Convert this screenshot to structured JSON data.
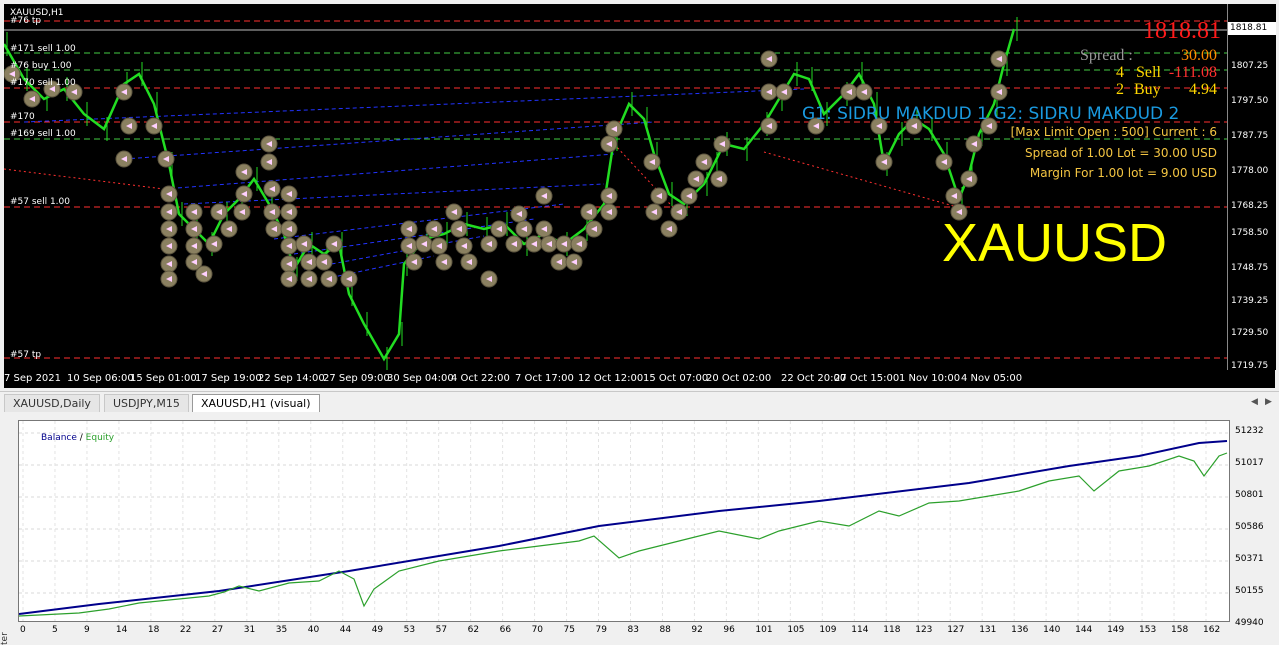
{
  "chart": {
    "window_title": "XAUUSD,H1",
    "current_price_tag": "1818.81",
    "price_ticks": [
      "1807.25",
      "1797.50",
      "1787.75",
      "1778.00",
      "1768.25",
      "1758.50",
      "1748.75",
      "1739.25",
      "1729.50",
      "1719.75"
    ],
    "time_ticks": [
      "7 Sep 2021",
      "10 Sep 06:00",
      "15 Sep 01:00",
      "17 Sep 19:00",
      "22 Sep 14:00",
      "27 Sep 09:00",
      "30 Sep 04:00",
      "4 Oct 22:00",
      "7 Oct 17:00",
      "12 Oct 12:00",
      "15 Oct 07:00",
      "20 Oct 02:00",
      "22 Oct 20:00",
      "27 Oct 15:00",
      "1 Nov 10:00",
      "4 Nov 05:00"
    ],
    "trade_labels": {
      "l1": "#76 tp",
      "l2": "#171 sell 1.00",
      "l3": "#76 buy 1.00",
      "l4": "#170 sell 1.00",
      "l5": "#170",
      "l6": "#169 sell 1.00",
      "l7": "#57 sell 1.00",
      "l8": "#57 tp"
    },
    "colors": {
      "price_line": "#22dd22",
      "marker": "#8a8060",
      "tp_line": "#ff3030",
      "sell_line": "#44ff44",
      "link_line": "#2233ff",
      "bg": "#000000"
    }
  },
  "overlay": {
    "price": "1818.81",
    "spread_label": "Spread :",
    "spread_value": "30.00",
    "sell_count": "4",
    "sell_label": "Sell",
    "sell_value": "-111.08",
    "buy_count": "2",
    "buy_label": "Buy",
    "buy_value": "4.94",
    "groups": "G1: SIDRU MAKDUD 1 G2: SIDRU MAKDUD 2",
    "max_limit": "[Max Limit Open : 500]  Current : 6",
    "spread_lot": "Spread of 1.00 Lot = 30.00  USD",
    "margin_lot": "Margin For 1.00 lot  =  9.00  USD",
    "symbol": "XAUUSD"
  },
  "tabs": [
    "XAUUSD,Daily",
    "USDJPY,M15",
    "XAUUSD,H1 (visual)"
  ],
  "active_tab": 2,
  "graph": {
    "legend_balance": "Balance",
    "legend_sep": " / ",
    "legend_equity": "Equity",
    "side_tab": "ter",
    "y_ticks": [
      "51232",
      "51017",
      "50801",
      "50586",
      "50371",
      "50155",
      "49940"
    ],
    "x_ticks": [
      "0",
      "5",
      "9",
      "14",
      "18",
      "22",
      "27",
      "31",
      "35",
      "40",
      "44",
      "49",
      "53",
      "57",
      "62",
      "66",
      "70",
      "75",
      "79",
      "83",
      "88",
      "92",
      "96",
      "101",
      "105",
      "109",
      "114",
      "118",
      "123",
      "127",
      "131",
      "136",
      "140",
      "144",
      "149",
      "153",
      "158",
      "162"
    ],
    "colors": {
      "balance": "#00008b",
      "equity": "#2ca02c"
    }
  }
}
